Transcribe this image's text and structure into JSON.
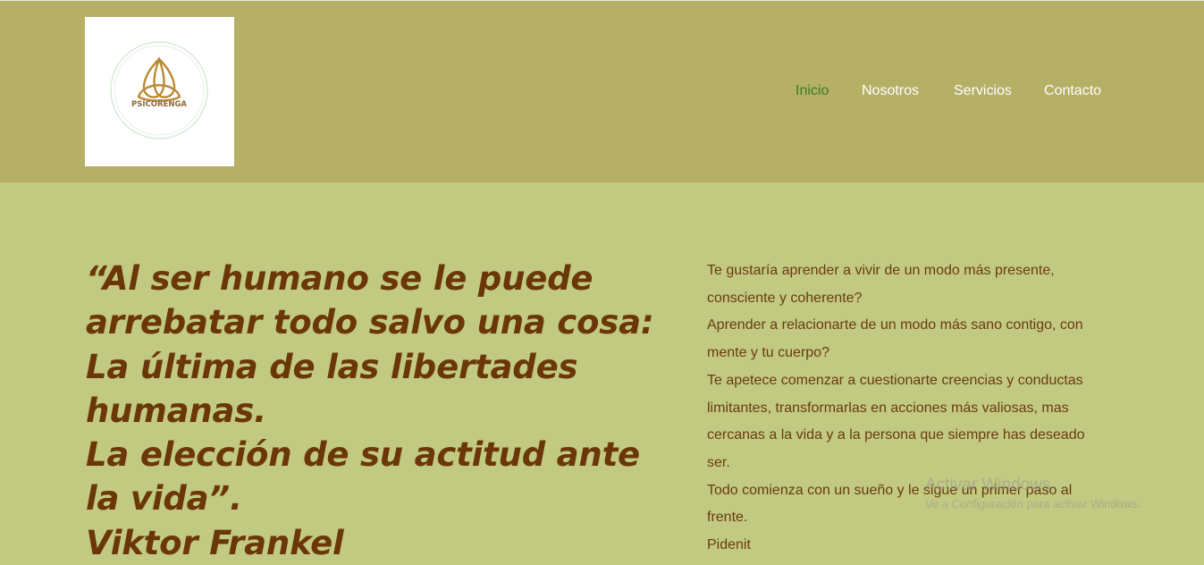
{
  "logo": {
    "text": "PSICORENGA"
  },
  "nav": {
    "items": [
      {
        "label": "Inicio",
        "active": true
      },
      {
        "label": "Nosotros",
        "active": false
      },
      {
        "label": "Servicios",
        "active": false
      },
      {
        "label": "Contacto",
        "active": false
      }
    ]
  },
  "quote": {
    "lines": [
      "“Al ser humano se le puede",
      "arrebatar todo salvo una cosa:",
      "La última de las libertades",
      "humanas.",
      "La elección de su actitud ante",
      "la vida”.",
      "Viktor Frankel"
    ]
  },
  "body": {
    "lines": [
      "Te gustaría aprender a vivir de un modo más presente,",
      "consciente y coherente?",
      "Aprender a relacionarte de un modo más sano contigo, con",
      "mente y tu cuerpo?",
      "Te apetece comenzar a cuestionarte  creencias y conductas",
      "limitantes, transformarlas en acciones más valiosas, mas",
      "cercanas a la vida y a la persona que siempre has deseado",
      "ser.",
      "Todo comienza con un sueño y le sigue un primer paso al",
      "frente.",
      "Pidenit"
    ]
  },
  "watermark": {
    "title": "Activar Windows",
    "subtitle": "Ve a Configuración para activar Windows."
  },
  "colors": {
    "header_bg": "#b5b065",
    "main_bg": "#c1ca80",
    "quote_text": "#6b3608",
    "body_text": "#6b3a14",
    "nav_active": "#3d7a2a",
    "nav_text": "#ffffff"
  }
}
